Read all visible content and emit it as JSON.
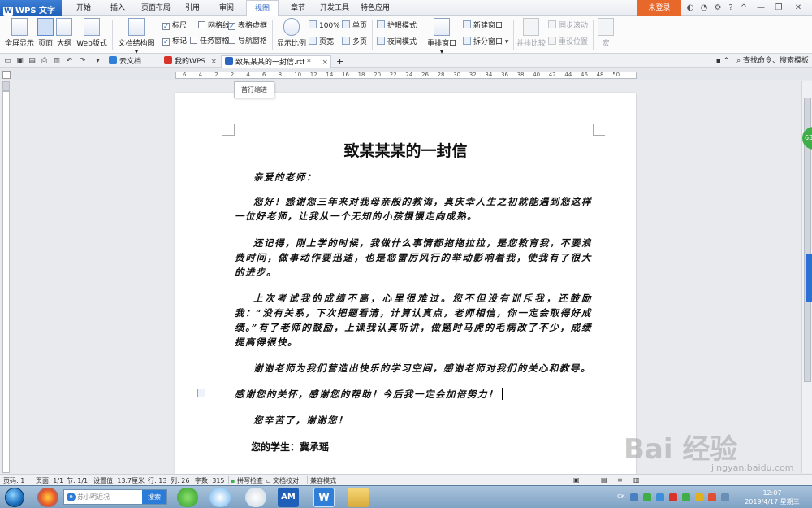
{
  "app": {
    "name": "WPS 文字",
    "menu_tabs": [
      "开始",
      "插入",
      "页面布局",
      "引用",
      "审阅",
      "视图",
      "章节",
      "开发工具",
      "特色应用"
    ],
    "active_tab": "视图",
    "login_label": "未登录"
  },
  "ribbon": {
    "fullscreen": "全屏显示",
    "page_view": "页面",
    "outline": "大纲",
    "web_layout": "Web版式",
    "doc_map": "文档结构图",
    "nav_pane": "导航窗格",
    "ruler": "标尺",
    "gridlines": "网格线",
    "table_gridlines": "表格虚框",
    "marks": "标记",
    "task_pane": "任务窗格",
    "zoom_label": "显示比例",
    "zoom_value": "100%",
    "page_width": "页宽",
    "single_page": "单页",
    "multi_page": "多页",
    "eye_mode": "护眼模式",
    "night_mode": "夜间模式",
    "arrange_windows": "重排窗口",
    "new_window": "新建窗口",
    "split_window": "拆分窗口",
    "side_by_side": "并排比较",
    "sync_scroll": "同步滚动",
    "reset_position": "重设位置",
    "macro": "宏"
  },
  "tabs": {
    "cloud_docs": "云文档",
    "my_wps": "我的WPS",
    "current_doc": "致某某某的一封信.rtf *",
    "find_command": "查找命令、搜索模板"
  },
  "ruler": {
    "ticks": [
      "6",
      "4",
      "2",
      "2",
      "4",
      "6",
      "8",
      "10",
      "12",
      "14",
      "16",
      "18",
      "20",
      "22",
      "24",
      "26",
      "28",
      "30",
      "32",
      "34",
      "36",
      "38",
      "40",
      "42",
      "44",
      "46",
      "48",
      "50"
    ],
    "tooltip": "首行缩进"
  },
  "document": {
    "title": "致某某某的一封信",
    "salutation": "亲爱的老师：",
    "paragraphs": [
      "您好！感谢您三年来对我母亲般的教诲，真庆幸人生之初就能遇到您这样一位好老师，让我从一个无知的小孩慢慢走向成熟。",
      "还记得，刚上学的时候，我做什么事情都拖拖拉拉，是您教育我，不要浪费时间，做事动作要迅速，也是您雷厉风行的举动影响着我，使我有了很大的进步。",
      "上次考试我的成绩不高，心里很难过。您不但没有训斥我，还鼓励我：“没有关系，下次把题看清，计算认真点，老师相信，你一定会取得好成绩。”有了老师的鼓励，上课我认真听讲，做题时马虎的毛病改了不少，成绩提高得很快。",
      "谢谢老师为我们营造出快乐的学习空间，感谢老师对我们的关心和教导。"
    ],
    "current_line": "感谢您的关怀，感谢您的帮助！今后我一定会加倍努力！",
    "thanks": "您辛苦了，谢谢您！",
    "signature": "您的学生：冀承瑶"
  },
  "side_badge": "63",
  "status": {
    "page": "页码: 1",
    "pages": "页面: 1/1",
    "section": "节: 1/1",
    "setting": "设置值: 13.7厘米",
    "row": "行: 13",
    "col": "列: 26",
    "wordcount": "字数: 315",
    "spellcheck": "拼写检查",
    "proofread": "文档校对",
    "compat": "兼容模式"
  },
  "taskbar": {
    "search_placeholder": "苏小明近况",
    "search_button": "搜索",
    "clock_time": "12:07",
    "clock_date": "2019/4/17 星期三",
    "tray_lang": "CK"
  },
  "watermark": {
    "text": "jingyan.baidu.com",
    "logo": "Bai 经验"
  }
}
